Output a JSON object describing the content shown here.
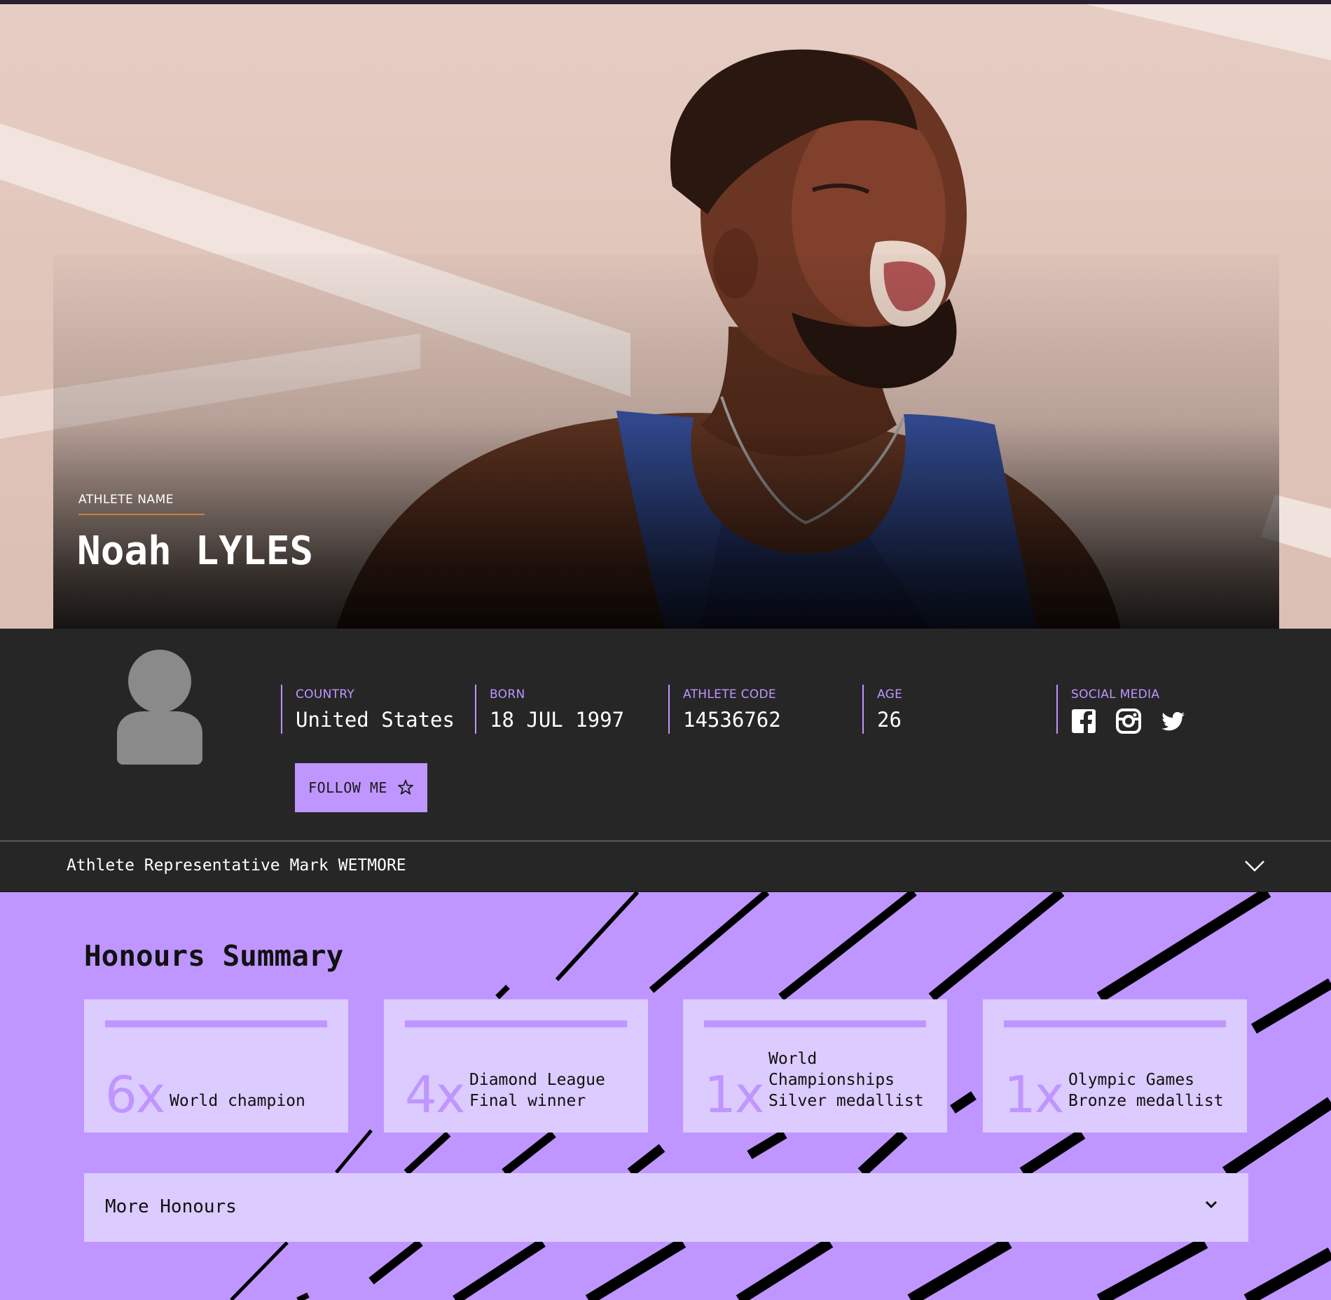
{
  "hero": {
    "label": "ATHLETE NAME",
    "name": "Noah LYLES"
  },
  "profile": {
    "stats": [
      {
        "label": "COUNTRY",
        "value": "United States"
      },
      {
        "label": "BORN",
        "value": "18 JUL 1997"
      },
      {
        "label": "ATHLETE CODE",
        "value": "14536762"
      },
      {
        "label": "AGE",
        "value": "26"
      }
    ],
    "social": {
      "label": "SOCIAL MEDIA",
      "icons": [
        "facebook-icon",
        "instagram-icon",
        "twitter-icon"
      ]
    },
    "follow_label": "FOLLOW ME",
    "follow_icon": "star-icon"
  },
  "representative": {
    "text": "Athlete Representative Mark WETMORE"
  },
  "honours": {
    "title": "Honours Summary",
    "cards": [
      {
        "count": "6x",
        "description": "World champion"
      },
      {
        "count": "4x",
        "description": "Diamond League\nFinal winner"
      },
      {
        "count": "1x",
        "description": "World\nChampionships\nSilver medallist"
      },
      {
        "count": "1x",
        "description": "Olympic Games\nBronze medallist"
      }
    ],
    "more_label": "More Honours"
  },
  "colors": {
    "accent": "#bf96ff",
    "accent_light": "#dccbff",
    "dark_bg": "#262626",
    "underline": "#c8823c"
  }
}
